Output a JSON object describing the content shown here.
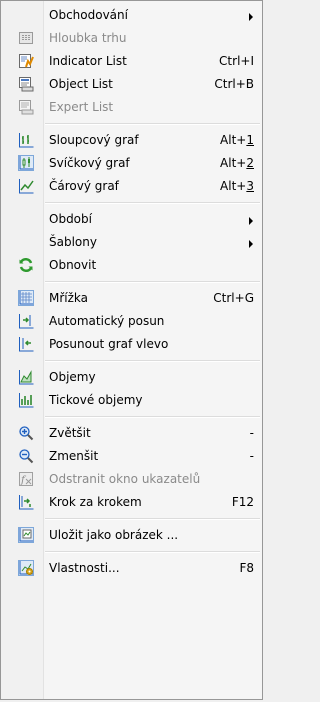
{
  "menu": {
    "group1": [
      {
        "label": "Obchodování",
        "submenu": true,
        "icon": "none"
      },
      {
        "label": "Hloubka trhu",
        "disabled": true,
        "icon": "depth-of-market-icon"
      },
      {
        "label": "Indicator List",
        "shortcut": "Ctrl+I",
        "icon": "indicator-list-icon"
      },
      {
        "label": "Object List",
        "shortcut": "Ctrl+B",
        "icon": "object-list-icon"
      },
      {
        "label": "Expert List",
        "disabled": true,
        "icon": "expert-list-icon"
      }
    ],
    "group2": [
      {
        "label": "Sloupcový graf",
        "shortcut_pre": "Alt+",
        "shortcut_key": "1",
        "icon": "bar-chart-icon"
      },
      {
        "label": "Svíčkový graf",
        "shortcut_pre": "Alt+",
        "shortcut_key": "2",
        "icon": "candlestick-chart-icon"
      },
      {
        "label": "Čárový graf",
        "shortcut_pre": "Alt+",
        "shortcut_key": "3",
        "icon": "line-chart-icon"
      }
    ],
    "group3": [
      {
        "label": "Období",
        "submenu": true
      },
      {
        "label": "Šablony",
        "submenu": true
      },
      {
        "label": "Obnovit",
        "icon": "refresh-icon"
      }
    ],
    "group4": [
      {
        "label": "Mřížka",
        "shortcut": "Ctrl+G",
        "icon": "grid-icon"
      },
      {
        "label": "Automatický posun",
        "icon": "auto-scroll-icon"
      },
      {
        "label": "Posunout graf vlevo",
        "icon": "chart-shift-icon"
      }
    ],
    "group5": [
      {
        "label": "Objemy",
        "icon": "volumes-icon"
      },
      {
        "label": "Tickové objemy",
        "icon": "tick-volumes-icon"
      }
    ],
    "group6": [
      {
        "label": "Zvětšit",
        "shortcut": "-",
        "icon": "zoom-in-icon"
      },
      {
        "label": "Zmenšit",
        "shortcut": "-",
        "icon": "zoom-out-icon"
      },
      {
        "label": "Odstranit okno ukazatelů",
        "disabled": true,
        "icon": "remove-indicator-window-icon"
      },
      {
        "label": "Krok za krokem",
        "shortcut": "F12",
        "icon": "step-by-step-icon"
      }
    ],
    "group7": [
      {
        "label": "Uložit jako obrázek ...",
        "icon": "save-as-picture-icon"
      }
    ],
    "group8": [
      {
        "label": "Vlastnosti...",
        "shortcut": "F8",
        "icon": "properties-icon"
      }
    ]
  },
  "colors": {
    "green": "#2f8a2f",
    "blue": "#1f5fbf",
    "gold": "#d9a81a",
    "disabled": "#8a8a8a"
  }
}
